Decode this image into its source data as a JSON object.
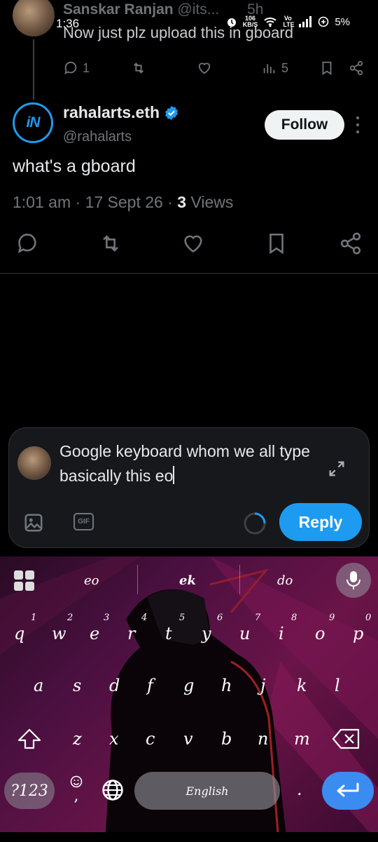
{
  "status_bar": {
    "time": "1:36",
    "net_speed_value": "106",
    "net_speed_unit": "KB/S",
    "volte": "Vo LTE",
    "battery": "5%"
  },
  "previous_tweet": {
    "author_name": "Sanskar Ranjan",
    "author_handle": "@its...",
    "time_ago": "5h",
    "text": "Now just plz upload this in gboard",
    "reply_count": "1",
    "view_count": "5"
  },
  "tweet": {
    "display_name": "rahalarts.eth",
    "handle": "@rahalarts",
    "avatar_text": "iN",
    "follow_label": "Follow",
    "text": "what's a gboard",
    "time": "1:01 am",
    "date": "17 Sept 26",
    "views_count": "3",
    "views_label": "Views"
  },
  "composer": {
    "text": "Google keyboard whom we all type basically this eo",
    "gif_label": "GIF",
    "reply_label": "Reply"
  },
  "keyboard": {
    "suggestions": [
      "eo",
      "ek",
      "do"
    ],
    "numbers": [
      "1",
      "2",
      "3",
      "4",
      "5",
      "6",
      "7",
      "8",
      "9",
      "0"
    ],
    "row1": [
      "q",
      "w",
      "e",
      "r",
      "t",
      "y",
      "u",
      "i",
      "o",
      "p"
    ],
    "row2": [
      "a",
      "s",
      "d",
      "f",
      "g",
      "h",
      "j",
      "k",
      "l"
    ],
    "row3": [
      "z",
      "x",
      "c",
      "v",
      "b",
      "n",
      "m"
    ],
    "symbols_label": "?123",
    "comma_label": ",",
    "space_label": "English",
    "period_label": "."
  },
  "colors": {
    "accent": "#1d9bf0",
    "background": "#000000",
    "muted_text": "#71767b"
  }
}
